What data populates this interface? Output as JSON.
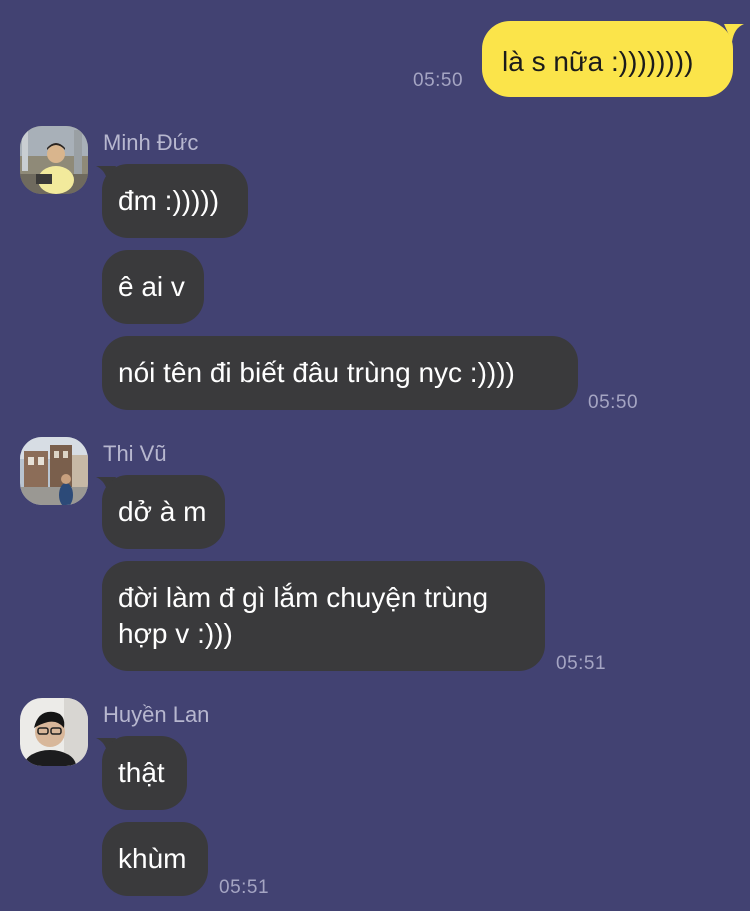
{
  "colors": {
    "background": "#424272",
    "incoming_bubble": "#3a3a3c",
    "outgoing_bubble": "#fbe44a",
    "timestamp": "#a5a5c3",
    "sender_name": "#b7b7cf"
  },
  "messages": {
    "out1": {
      "text": "là s nữa :))))))))",
      "time": "05:50"
    },
    "minh": {
      "name": "Minh Đức",
      "m1": "đm :)))))",
      "m2": "ê ai v",
      "m3": "nói tên đi biết đâu trùng nyc :))))",
      "time": "05:50"
    },
    "thi": {
      "name": "Thi Vũ",
      "m1": "dở à m",
      "m2": "đời làm đ gì lắm chuyện trùng hợp v :)))",
      "time": "05:51"
    },
    "huyen": {
      "name": "Huyền Lan",
      "m1": "thật",
      "m2": "khùm",
      "time": "05:51"
    }
  },
  "icons": {
    "minh_avatar": "avatar-photo-person-yellow-shirt",
    "thi_avatar": "avatar-photo-street-buildings",
    "huyen_avatar": "avatar-photo-person-glasses"
  }
}
